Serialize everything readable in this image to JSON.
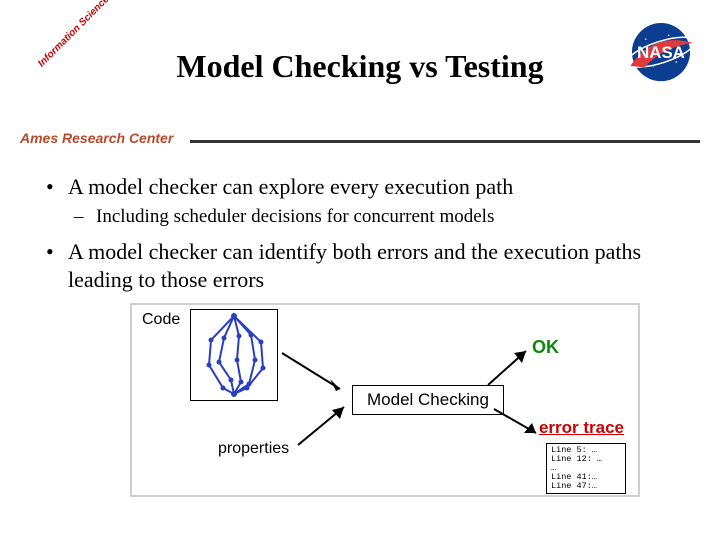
{
  "header": {
    "corner_label": "Information Sciences & Technology",
    "title": "Model Checking vs Testing",
    "ames_label": "Ames Research Center",
    "nasa_text": "NASA"
  },
  "bullets": {
    "b1": "A model checker can explore every execution path",
    "b1_sub": "Including scheduler decisions for concurrent models",
    "b2": "A model checker can identify both errors and the execution paths leading to those errors"
  },
  "diagram": {
    "code_label": "Code",
    "mc_label": "Model Checking",
    "props_label": "properties",
    "ok_label": "OK",
    "error_label": "error trace",
    "trace_lines": {
      "l1": "Line 5: …",
      "l2": "Line 12: …",
      "l3": "…",
      "l4": "Line 41:…",
      "l5": "Line 47:…"
    }
  }
}
